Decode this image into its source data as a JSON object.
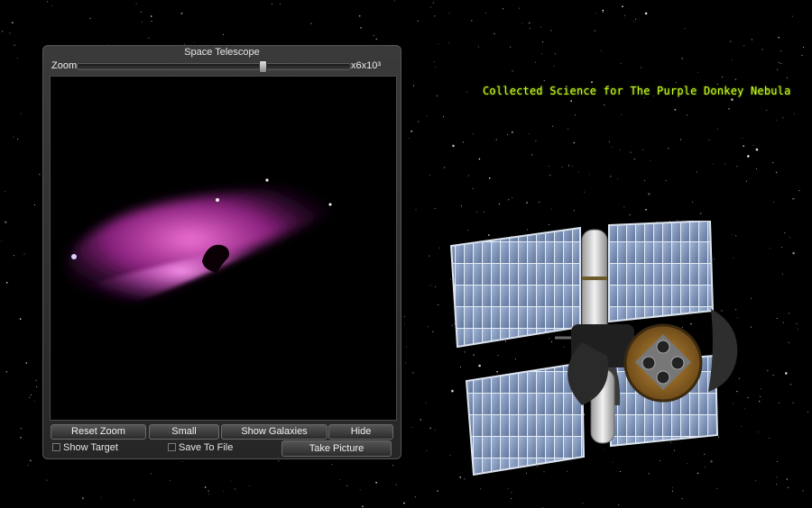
{
  "telescope": {
    "title": "Space Telescope",
    "zoom_label": "Zoom",
    "zoom_value": "x6x10³",
    "zoom_level": 0.68,
    "buttons": {
      "reset_zoom": "Reset Zoom",
      "small": "Small",
      "show_galaxies": "Show Galaxies",
      "hide": "Hide",
      "take_picture": "Take Picture"
    },
    "checkboxes": {
      "show_target": {
        "label": "Show Target",
        "checked": false
      },
      "save_to_file": {
        "label": "Save To File",
        "checked": false
      }
    }
  },
  "hud": {
    "science_text": "Collected Science for The Purple Donkey Nebula",
    "science_color": "#c8ff22"
  },
  "scene": {
    "nebula_colors": [
      "#ff4fd0",
      "#b21ea0",
      "#5a1a6a"
    ],
    "space_color": "#000000"
  }
}
